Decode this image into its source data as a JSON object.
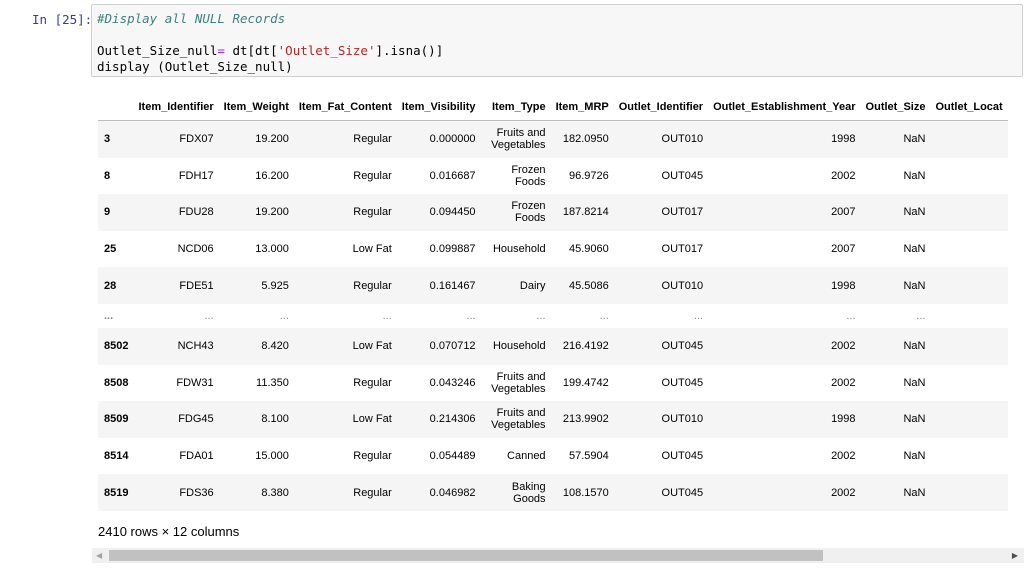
{
  "cell": {
    "prompt": "In [25]:",
    "code": {
      "comment": "#Display all NULL Records",
      "line2_var": "Outlet_Size_null",
      "line2_op": "=",
      "line2_a": " dt[dt[",
      "line2_str": "'Outlet_Size'",
      "line2_b": "].isna()]",
      "line3": "display (Outlet_Size_null)"
    }
  },
  "table": {
    "columns": [
      "",
      "Item_Identifier",
      "Item_Weight",
      "Item_Fat_Content",
      "Item_Visibility",
      "Item_Type",
      "Item_MRP",
      "Outlet_Identifier",
      "Outlet_Establishment_Year",
      "Outlet_Size",
      "Outlet_Locat"
    ],
    "rows": [
      [
        "3",
        "FDX07",
        "19.200",
        "Regular",
        "0.000000",
        "Fruits and Vegetables",
        "182.0950",
        "OUT010",
        "1998",
        "NaN",
        ""
      ],
      [
        "8",
        "FDH17",
        "16.200",
        "Regular",
        "0.016687",
        "Frozen Foods",
        "96.9726",
        "OUT045",
        "2002",
        "NaN",
        ""
      ],
      [
        "9",
        "FDU28",
        "19.200",
        "Regular",
        "0.094450",
        "Frozen Foods",
        "187.8214",
        "OUT017",
        "2007",
        "NaN",
        ""
      ],
      [
        "25",
        "NCD06",
        "13.000",
        "Low Fat",
        "0.099887",
        "Household",
        "45.9060",
        "OUT017",
        "2007",
        "NaN",
        ""
      ],
      [
        "28",
        "FDE51",
        "5.925",
        "Regular",
        "0.161467",
        "Dairy",
        "45.5086",
        "OUT010",
        "1998",
        "NaN",
        ""
      ],
      [
        "...",
        "...",
        "...",
        "...",
        "...",
        "...",
        "...",
        "...",
        "...",
        "...",
        ""
      ],
      [
        "8502",
        "NCH43",
        "8.420",
        "Low Fat",
        "0.070712",
        "Household",
        "216.4192",
        "OUT045",
        "2002",
        "NaN",
        ""
      ],
      [
        "8508",
        "FDW31",
        "11.350",
        "Regular",
        "0.043246",
        "Fruits and Vegetables",
        "199.4742",
        "OUT045",
        "2002",
        "NaN",
        ""
      ],
      [
        "8509",
        "FDG45",
        "8.100",
        "Low Fat",
        "0.214306",
        "Fruits and Vegetables",
        "213.9902",
        "OUT010",
        "1998",
        "NaN",
        ""
      ],
      [
        "8514",
        "FDA01",
        "15.000",
        "Regular",
        "0.054489",
        "Canned",
        "57.5904",
        "OUT045",
        "2002",
        "NaN",
        ""
      ],
      [
        "8519",
        "FDS36",
        "8.380",
        "Regular",
        "0.046982",
        "Baking Goods",
        "108.1570",
        "OUT045",
        "2002",
        "NaN",
        ""
      ]
    ]
  },
  "summary": "2410 rows × 12 columns",
  "scrollbar": {
    "left_arrow": "◀",
    "right_arrow": "▶"
  }
}
